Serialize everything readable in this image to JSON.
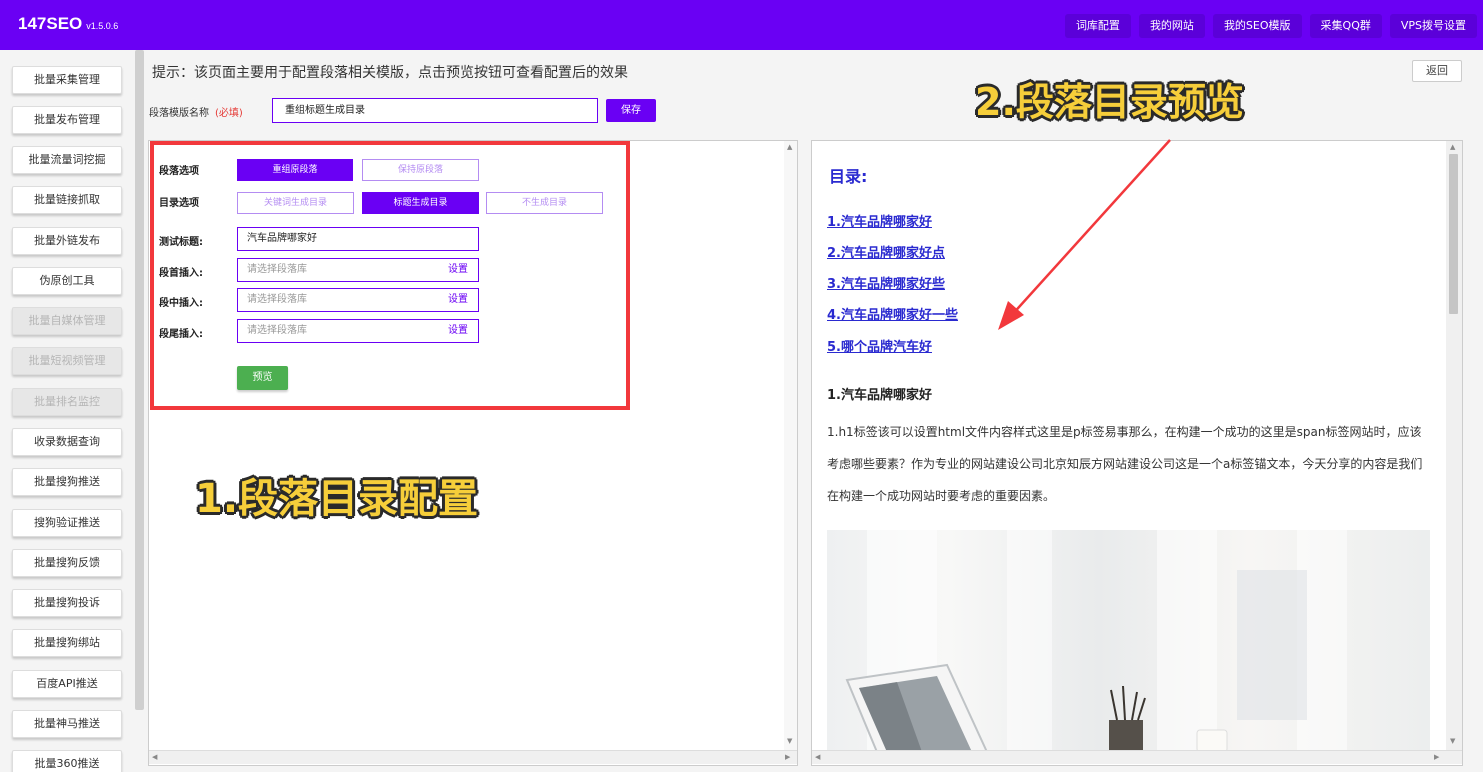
{
  "app": {
    "brand": "147SEO",
    "version": "v1.5.0.6"
  },
  "topnav": [
    "词库配置",
    "我的网站",
    "我的SEO模版",
    "采集QQ群",
    "VPS拨号设置"
  ],
  "sidebar": [
    {
      "label": "批量采集管理",
      "disabled": false
    },
    {
      "label": "批量发布管理",
      "disabled": false
    },
    {
      "label": "批量流量词挖掘",
      "disabled": false
    },
    {
      "label": "批量链接抓取",
      "disabled": false
    },
    {
      "label": "批量外链发布",
      "disabled": false
    },
    {
      "label": "伪原创工具",
      "disabled": false
    },
    {
      "label": "批量自媒体管理",
      "disabled": true
    },
    {
      "label": "批量短视频管理",
      "disabled": true
    },
    {
      "label": "批量排名监控",
      "disabled": true
    },
    {
      "label": "收录数据查询",
      "disabled": false
    },
    {
      "label": "批量搜狗推送",
      "disabled": false
    },
    {
      "label": "搜狗验证推送",
      "disabled": false
    },
    {
      "label": "批量搜狗反馈",
      "disabled": false
    },
    {
      "label": "批量搜狗投诉",
      "disabled": false
    },
    {
      "label": "批量搜狗绑站",
      "disabled": false
    },
    {
      "label": "百度API推送",
      "disabled": false
    },
    {
      "label": "批量神马推送",
      "disabled": false
    },
    {
      "label": "批量360推送",
      "disabled": false
    }
  ],
  "main": {
    "tip": "提示：该页面主要用于配置段落相关模版，点击预览按钮可查看配置后的效果",
    "back_label": "返回",
    "name_label": "段落模版名称",
    "name_required": "(必填)",
    "name_value": "重组标题生成目录",
    "save_label": "保存"
  },
  "config": {
    "paragraph_label": "段落选项",
    "paragraph_options": [
      "重组原段落",
      "保持原段落"
    ],
    "toc_label": "目录选项",
    "toc_options": [
      "关键词生成目录",
      "标题生成目录",
      "不生成目录"
    ],
    "test_title_label": "测试标题:",
    "test_title_value": "汽车品牌哪家好",
    "head_insert_label": "段首插入:",
    "mid_insert_label": "段中插入:",
    "tail_insert_label": "段尾插入:",
    "insert_placeholder": "请选择段落库",
    "set_label": "设置",
    "preview_label": "预览"
  },
  "preview": {
    "toc_title": "目录:",
    "toc_items": [
      "1.汽车品牌哪家好",
      "2.汽车品牌哪家好点",
      "3.汽车品牌哪家好些",
      "4.汽车品牌哪家好一些",
      "5.哪个品牌汽车好"
    ],
    "section_title": "1.汽车品牌哪家好",
    "section_text": "1.h1标签该可以设置html文件内容样式这里是p标签易事那么，在构建一个成功的这里是span标签网站时，应该考虑哪些要素？作为专业的网站建设公司北京知辰方网站建设公司这是一个a标签锚文本，今天分享的内容是我们在构建一个成功网站时要考虑的重要因素。"
  },
  "annotations": {
    "config": "1.段落目录配置",
    "preview": "2.段落目录预览"
  },
  "colors": {
    "brand": "#6a00f4",
    "preview_button": "#4caf50",
    "highlight_box": "#f2383c",
    "annotation": "#f6ce3a",
    "link": "#2a2ad0"
  }
}
